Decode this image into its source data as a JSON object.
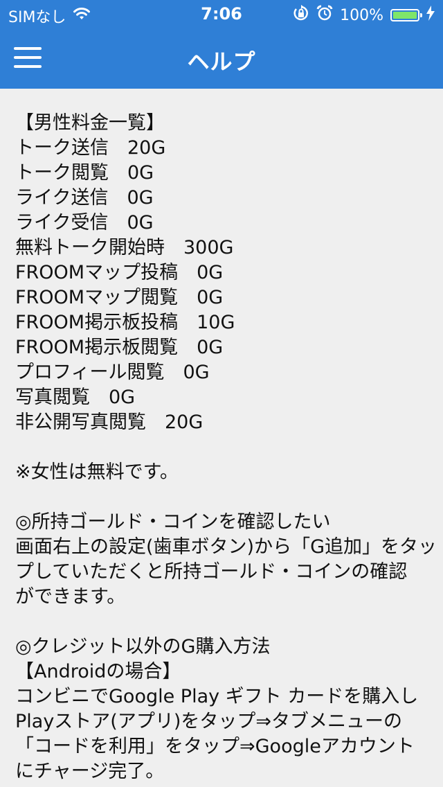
{
  "status_bar": {
    "carrier": "SIMなし",
    "time": "7:06",
    "battery_percent": "100%",
    "battery_level": 1.0,
    "icons": [
      "wifi-icon",
      "orientation-lock-icon",
      "alarm-icon",
      "battery-icon",
      "charging-icon"
    ]
  },
  "header": {
    "title": "ヘルプ",
    "menu_icon": "hamburger-menu-icon",
    "background": "#2f7fd6"
  },
  "content": {
    "fees_heading": "【男性料金一覧】",
    "fees": [
      "トーク送信　20G",
      "トーク閲覧　0G",
      "ライク送信　0G",
      "ライク受信　0G",
      "無料トーク開始時　300G",
      "FROOMマップ投稿　0G",
      "FROOMマップ閲覧　0G",
      "FROOM掲示板投稿　10G",
      "FROOM掲示板閲覧　0G",
      "プロフィール閲覧　0G",
      "写真閲覧　0G",
      "非公開写真閲覧　20G"
    ],
    "female_note": "※女性は無料です。",
    "gold_heading": "◎所持ゴールド・コインを確認したい",
    "gold_lines": [
      "画面右上の設定(歯車ボタン)から「G追加」をタッ",
      "プしていただくと所持ゴールド・コインの確認",
      "ができます。"
    ],
    "purchase_heading": "◎クレジット以外のG購入方法",
    "android_heading": "【Androidの場合】",
    "android_lines": [
      "コンビニでGoogle Play ギフト カードを購入し",
      "Playストア(アプリ)をタップ⇒タブメニューの",
      "「コードを利用」をタップ⇒Googleアカウント",
      "にチャージ完了。"
    ]
  }
}
